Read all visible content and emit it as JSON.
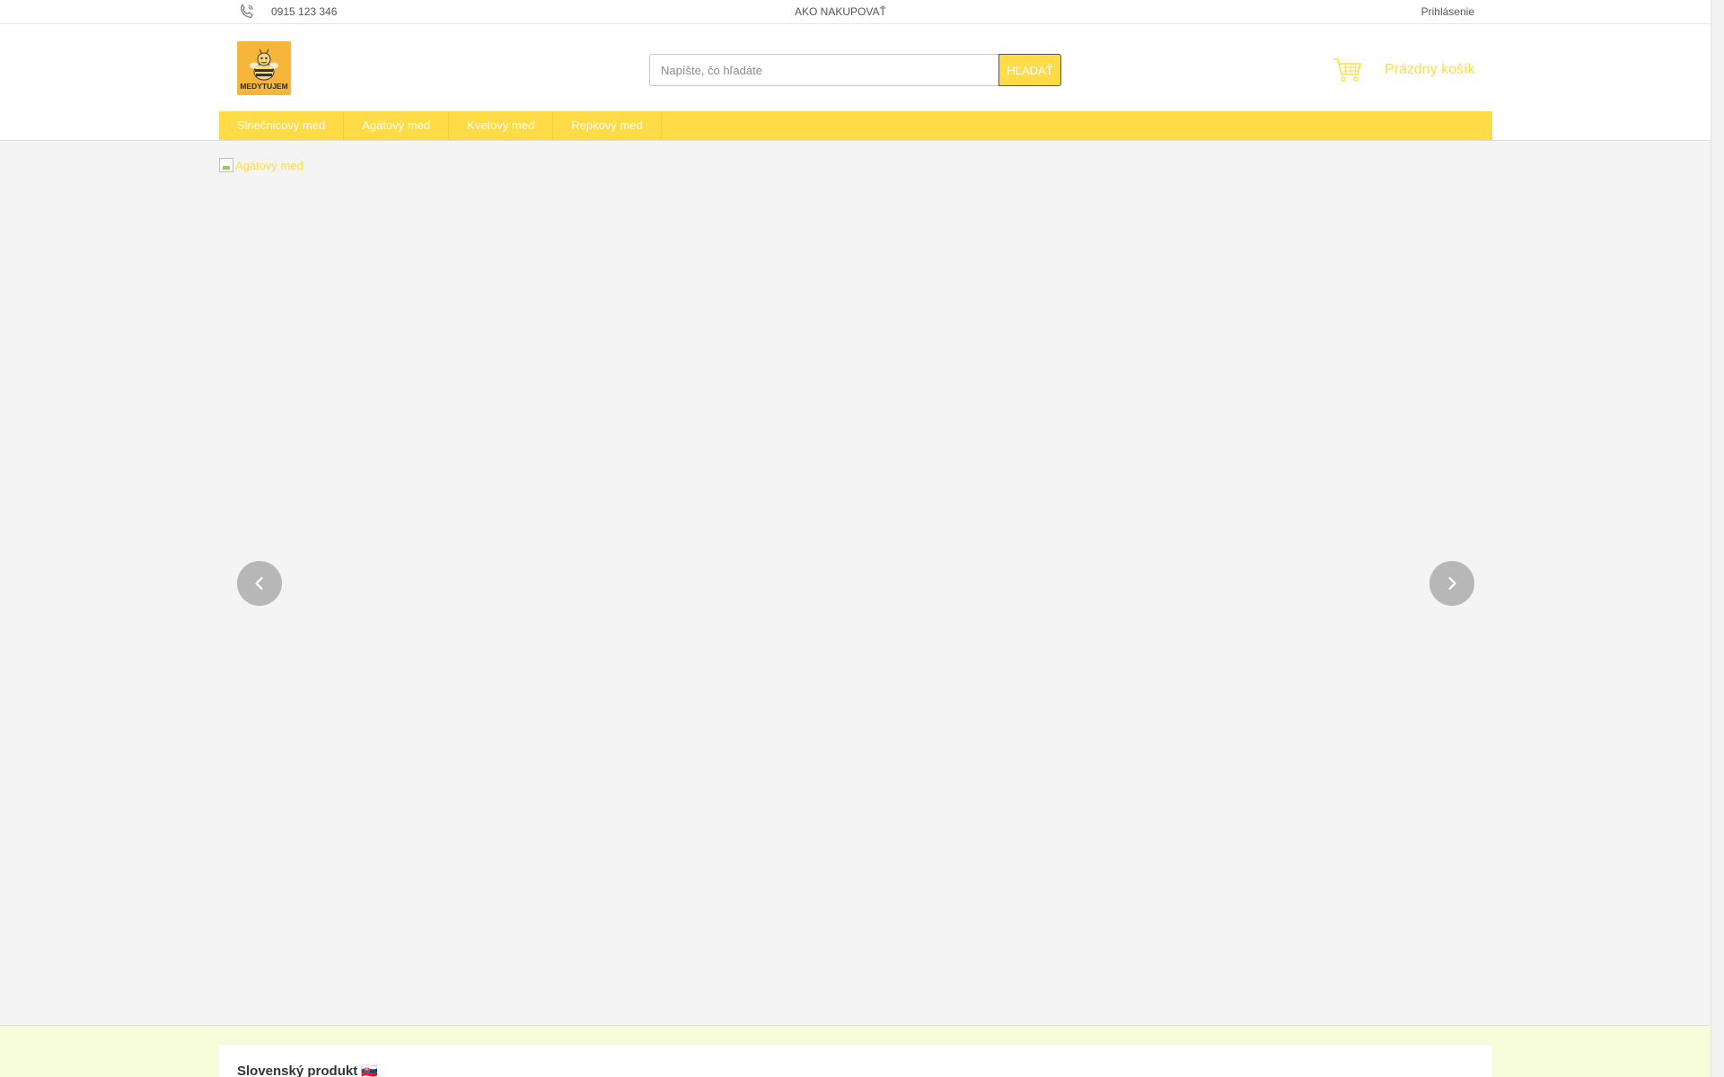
{
  "topbar": {
    "phone": "0915 123 346",
    "how_to_shop": "AKO NAKUPOVAŤ",
    "login": "Prihlásenie"
  },
  "header": {
    "logo_text": "MEDYTUJEM",
    "search_placeholder": "Napíšte, čo hľadáte",
    "search_button": "HĽADAŤ",
    "cart_label": "Prázdny košík"
  },
  "nav": {
    "items": [
      {
        "label": "Slnečnicový med"
      },
      {
        "label": "Agátový med"
      },
      {
        "label": "Kvetový med"
      },
      {
        "label": "Repkový med"
      }
    ]
  },
  "hero": {
    "image_alt": "Agátový med"
  },
  "section": {
    "title": "Slovenský produkt 🇸🇰"
  },
  "colors": {
    "accent": "#fedb47",
    "page_bg": "#f6fbd9",
    "hero_bg": "#f4f4f4"
  },
  "icons": [
    "phone-icon",
    "cart-icon",
    "chevron-left-icon",
    "chevron-right-icon",
    "broken-image-icon"
  ]
}
